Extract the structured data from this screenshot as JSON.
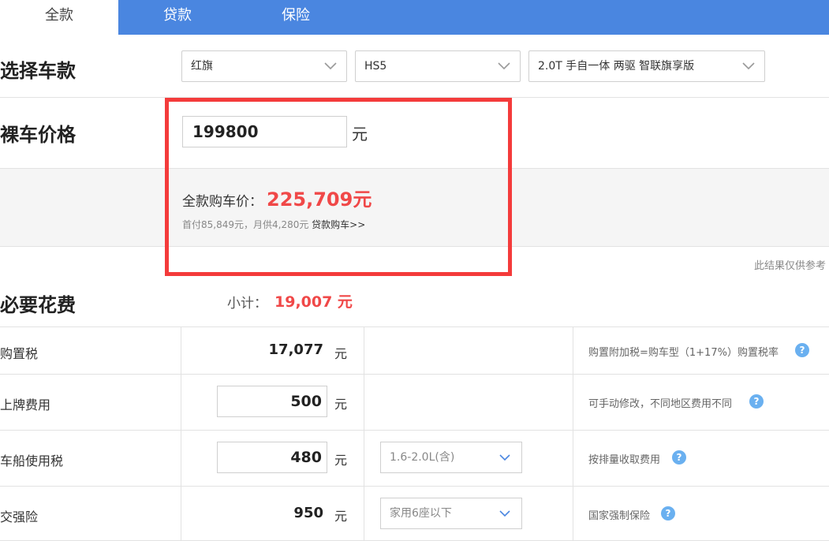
{
  "tabs": [
    {
      "label": "全款",
      "active": true
    },
    {
      "label": "贷款",
      "active": false
    },
    {
      "label": "保险",
      "active": false
    }
  ],
  "select_model": {
    "title": "选择车款",
    "brand": "红旗",
    "series": "HS5",
    "version": "2.0T 手自一体 两驱 智联旗享版"
  },
  "bare_price": {
    "title": "裸车价格",
    "value": "199800",
    "unit": "元"
  },
  "total": {
    "label": "全款购车价：",
    "value": "225,709元",
    "sub_text": "首付85,849元，月供4,280元",
    "loan_link": "贷款购车>>"
  },
  "disclaimer": "此结果仅供参考",
  "required_fees": {
    "title": "必要花费",
    "subtotal_label": "小计：",
    "subtotal_value": "19,007 元",
    "rows": [
      {
        "label": "购置税",
        "value": "17,077",
        "unit": "元",
        "note": "购置附加税=购车型（1+17%）购置税率"
      },
      {
        "label": "上牌费用",
        "value": "500",
        "unit": "元",
        "note": "可手动修改，不同地区费用不同"
      },
      {
        "label": "车船使用税",
        "value": "480",
        "unit": "元",
        "option": "1.6-2.0L(含)",
        "note": "按排量收取费用"
      },
      {
        "label": "交强险",
        "value": "950",
        "unit": "元",
        "option": "家用6座以下",
        "note": "国家强制保险"
      }
    ]
  },
  "colors": {
    "tab_bar": "#4a86e0",
    "highlight_border": "#f43b3b",
    "price_red": "#f04848",
    "help_icon": "#6ab0f0"
  }
}
